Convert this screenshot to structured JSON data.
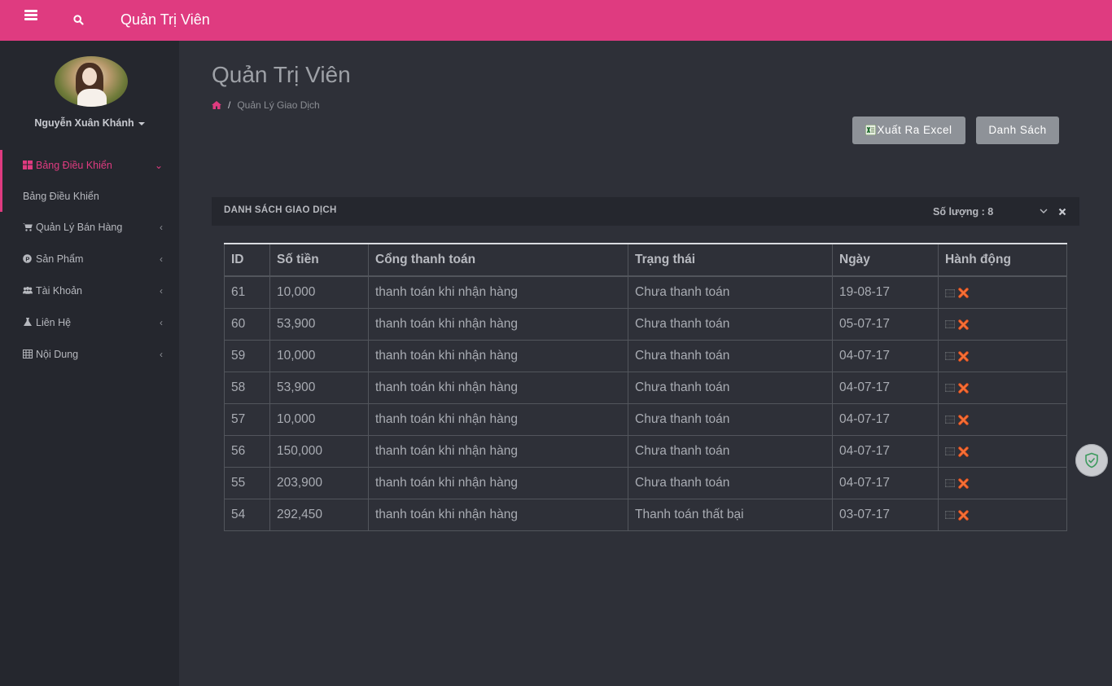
{
  "app": {
    "title": "Quản Trị Viên"
  },
  "colors": {
    "accent": "#df3b80",
    "background": "#2e3038",
    "sidebar": "#25272e",
    "button": "#8e9298"
  },
  "user": {
    "name": "Nguyễn Xuân Khánh"
  },
  "sidebar": {
    "items": [
      {
        "label": "Bảng Điều Khiển",
        "icon": "dashboard-icon",
        "active": true
      },
      {
        "label": "Quản Lý Bán Hàng",
        "icon": "cart-icon"
      },
      {
        "label": "Sản Phẩm",
        "icon": "product-icon"
      },
      {
        "label": "Tài Khoản",
        "icon": "users-icon"
      },
      {
        "label": "Liên Hệ",
        "icon": "flask-icon"
      },
      {
        "label": "Nội Dung",
        "icon": "table-icon"
      }
    ],
    "submenu": {
      "label": "Bảng Điều Khiển"
    }
  },
  "page": {
    "title": "Quản Trị Viên",
    "breadcrumb": {
      "current": "Quản Lý Giao Dịch"
    }
  },
  "actions": {
    "export_label": "Xuất Ra Excel",
    "list_label": "Danh Sách"
  },
  "panel": {
    "title": "DANH SÁCH GIAO DỊCH",
    "count_label": "Số lượng : 8"
  },
  "table": {
    "headers": [
      "ID",
      "Số tiền",
      "Cổng thanh toán",
      "Trạng thái",
      "Ngày",
      "Hành động"
    ],
    "rows": [
      [
        "61",
        "10,000",
        "thanh toán khi nhận hàng",
        "Chưa thanh toán",
        "19-08-17"
      ],
      [
        "60",
        "53,900",
        "thanh toán khi nhận hàng",
        "Chưa thanh toán",
        "05-07-17"
      ],
      [
        "59",
        "10,000",
        "thanh toán khi nhận hàng",
        "Chưa thanh toán",
        "04-07-17"
      ],
      [
        "58",
        "53,900",
        "thanh toán khi nhận hàng",
        "Chưa thanh toán",
        "04-07-17"
      ],
      [
        "57",
        "10,000",
        "thanh toán khi nhận hàng",
        "Chưa thanh toán",
        "04-07-17"
      ],
      [
        "56",
        "150,000",
        "thanh toán khi nhận hàng",
        "Chưa thanh toán",
        "04-07-17"
      ],
      [
        "55",
        "203,900",
        "thanh toán khi nhận hàng",
        "Chưa thanh toán",
        "04-07-17"
      ],
      [
        "54",
        "292,450",
        "thanh toán khi nhận hàng",
        "Thanh toán thất bại",
        "03-07-17"
      ]
    ]
  }
}
